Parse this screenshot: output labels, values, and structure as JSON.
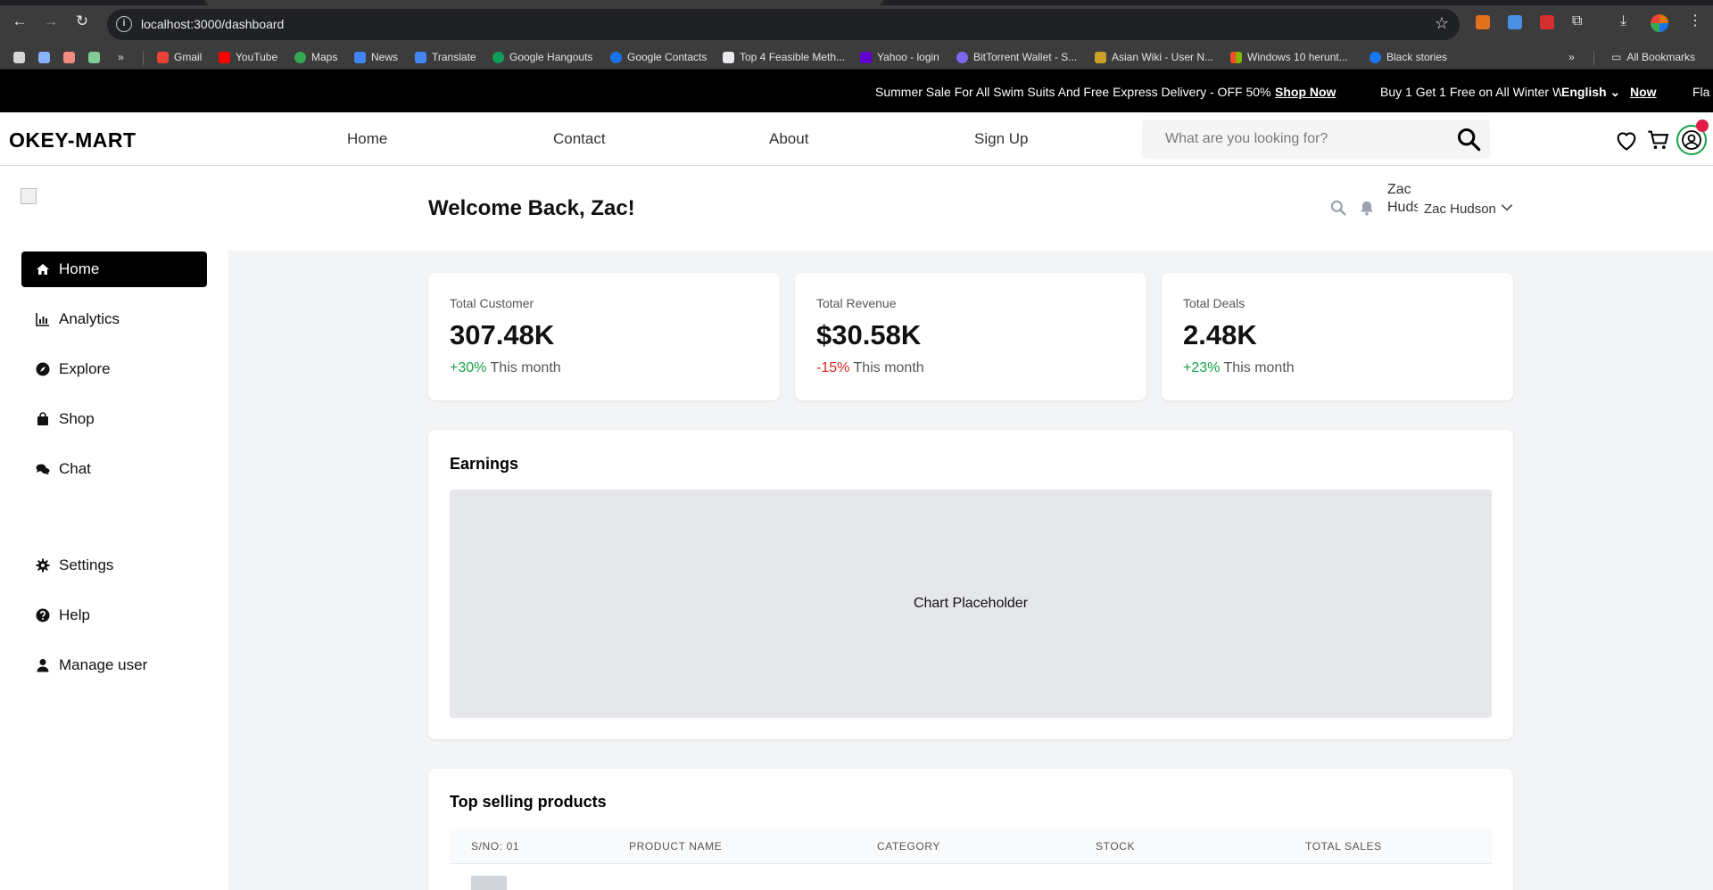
{
  "browser": {
    "url": "localhost:3000/dashboard",
    "bookmarks": [
      "Gmail",
      "YouTube",
      "Maps",
      "News",
      "Translate",
      "Google Hangouts",
      "Google Contacts",
      "Top 4 Feasible Meth...",
      "Yahoo - login",
      "BitTorrent Wallet - S...",
      "Asian Wiki - User N...",
      "Windows 10 herunt...",
      "Black stories"
    ],
    "all_bookmarks": "All Bookmarks",
    "overflow": "»"
  },
  "promo": {
    "message": "Summer Sale For All Swim Suits And Free Express Delivery - OFF 50%",
    "shop_now": "Shop Now",
    "message2": "Buy 1 Get 1 Free on All Winter W",
    "language": "English",
    "shop_now_2": "Now",
    "message3": "Fla"
  },
  "header": {
    "logo": "OKEY-MART",
    "nav": [
      "Home",
      "Contact",
      "About",
      "Sign Up"
    ],
    "search_placeholder": "What are you looking for?"
  },
  "sidebar": {
    "items": [
      {
        "label": "Home",
        "icon": "home-icon",
        "active": true
      },
      {
        "label": "Analytics",
        "icon": "bar-chart-icon"
      },
      {
        "label": "Explore",
        "icon": "compass-icon"
      },
      {
        "label": "Shop",
        "icon": "shopping-bag-icon"
      },
      {
        "label": "Chat",
        "icon": "chat-icon"
      }
    ],
    "bottom_items": [
      {
        "label": "Settings",
        "icon": "gear-icon"
      },
      {
        "label": "Help",
        "icon": "help-icon"
      },
      {
        "label": "Manage user",
        "icon": "user-icon"
      }
    ]
  },
  "topbar": {
    "welcome": "Welcome Back, Zac!",
    "avatar_alt": "Zac Hudson",
    "user_name": "Zac Hudson"
  },
  "stats": [
    {
      "label": "Total Customer",
      "value": "307.48K",
      "change": "+30%",
      "period": "This month",
      "trend": "up"
    },
    {
      "label": "Total Revenue",
      "value": "$30.58K",
      "change": "-15%",
      "period": "This month",
      "trend": "down"
    },
    {
      "label": "Total Deals",
      "value": "2.48K",
      "change": "+23%",
      "period": "This month",
      "trend": "up"
    }
  ],
  "earnings": {
    "title": "Earnings",
    "placeholder": "Chart Placeholder"
  },
  "top_products": {
    "title": "Top selling products",
    "columns": [
      "S/NO: 01",
      "PRODUCT NAME",
      "CATEGORY",
      "STOCK",
      "TOTAL SALES"
    ]
  },
  "colors": {
    "positive": "#16a34a",
    "negative": "#dc2626",
    "sidebar_active": "#000000",
    "promo_bg": "#000000",
    "page_bg": "#f3f4f6"
  }
}
